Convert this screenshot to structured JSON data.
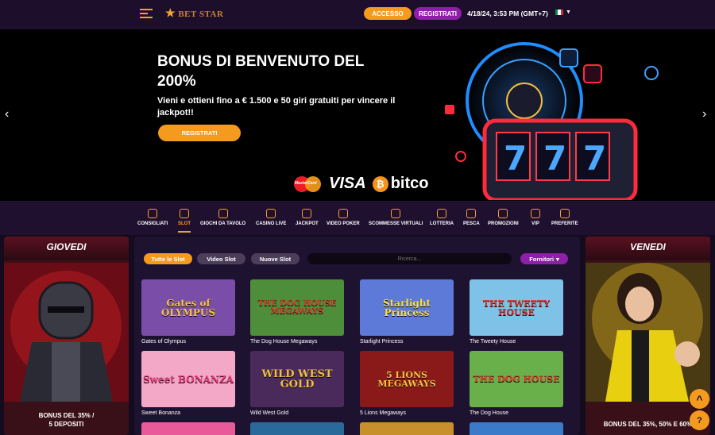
{
  "header": {
    "logo_text": "BET STAR",
    "login_label": "ACCESSO",
    "register_label": "REGISTRATI",
    "datetime": "4/18/24, 3:53 PM (GMT+7)",
    "language_flag": "italy-flag-icon"
  },
  "hero": {
    "title": "BONUS DI BENVENUTO DEL 200%",
    "subtitle": "Vieni e ottieni fino a € 1.500 e 50 giri gratuiti per vincere il jackpot!!",
    "cta_label": "REGISTRATI",
    "payment_mastercard": "MasterCard",
    "payment_visa": "VISA",
    "payment_bitcoin": "bitcoin"
  },
  "categories": [
    {
      "label": "CONSIGLIATI",
      "icon": "thumbs-up-icon"
    },
    {
      "label": "SLOT",
      "icon": "slot-icon",
      "active": true
    },
    {
      "label": "GIOCHI DA TAVOLO",
      "icon": "cards-icon"
    },
    {
      "label": "CASINO LIVE",
      "icon": "roulette-icon"
    },
    {
      "label": "JACKPOT",
      "icon": "jackpot-icon"
    },
    {
      "label": "VIDEO POKER",
      "icon": "poker-icon"
    },
    {
      "label": "SCOMMESSE VIRTUALI",
      "icon": "horse-icon"
    },
    {
      "label": "LOTTERIA",
      "icon": "lottery-icon"
    },
    {
      "label": "PESCA",
      "icon": "fishing-hook-icon"
    },
    {
      "label": "PROMOZIONI",
      "icon": "gift-icon"
    },
    {
      "label": "VIP",
      "icon": "crown-icon"
    },
    {
      "label": "PREFERITE",
      "icon": "heart-icon"
    }
  ],
  "filters": {
    "all_slots": "Tutte le Slot",
    "video_slot": "Video Slot",
    "new_slots": "Nuove Slot",
    "search_placeholder": "Ricerca...",
    "providers": "Fornitori"
  },
  "left_panel": {
    "title": "GIOVEDI",
    "caption_line1": "BONUS DEL 35% /",
    "caption_line2": "5 DEPOSITI"
  },
  "right_panel": {
    "title": "VENEDI",
    "caption": "BONUS DEL 35%, 50% E 60%"
  },
  "games": [
    {
      "name": "Gates of Olympus",
      "logo": "Gates of OLYMPUS",
      "bg": "#7a4ea8",
      "logo_color": "#f5c542"
    },
    {
      "name": "The Dog House Megaways",
      "logo": "THE DOG HOUSE MEGAWAYS",
      "bg": "#4e8e3a",
      "logo_color": "#d8402a"
    },
    {
      "name": "Starlight Princess",
      "logo": "Starlight Princess",
      "bg": "#5e7ad8",
      "logo_color": "#f7e04a"
    },
    {
      "name": "The Tweety House",
      "logo": "THE TWEETY HOUSE",
      "bg": "#7fc2e8",
      "logo_color": "#d8302a"
    },
    {
      "name": "Sweet Bonanza",
      "logo": "Sweet BONANZA",
      "bg": "#f4a8c8",
      "logo_color": "#e83a7a"
    },
    {
      "name": "Wild West Gold",
      "logo": "WILD WEST GOLD",
      "bg": "#4a2a5a",
      "logo_color": "#f0c040"
    },
    {
      "name": "5 Lions Megaways",
      "logo": "5 LIONS MEGAWAYS",
      "bg": "#8a1a1a",
      "logo_color": "#f5c542"
    },
    {
      "name": "The Dog House",
      "logo": "THE DOG HOUSE",
      "bg": "#6ab04a",
      "logo_color": "#d8402a"
    }
  ],
  "floating": {
    "scroll_up": "^",
    "support": "?"
  }
}
